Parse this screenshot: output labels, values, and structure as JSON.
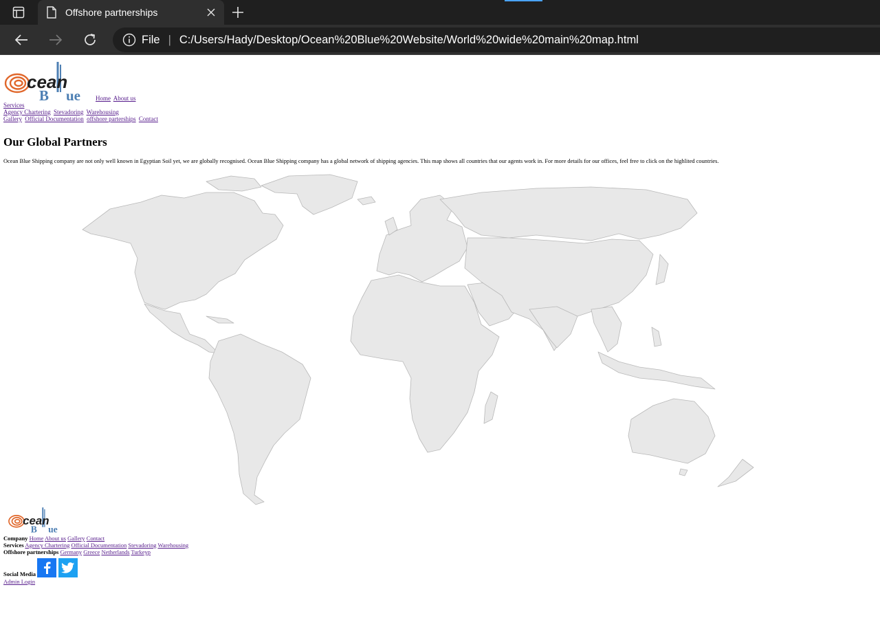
{
  "browser": {
    "tab_title": "Offshore partnerships",
    "address_scheme": "File",
    "address_separator": "|",
    "url": "C:/Users/Hady/Desktop/Ocean%20Blue%20Website/World%20wide%20main%20map.html"
  },
  "logo": {
    "word1": "cean",
    "word2a": "B",
    "word2b": "ue"
  },
  "header_nav": {
    "row1": [
      "Home",
      "About us"
    ],
    "row2": [
      "Services"
    ],
    "row3": [
      "Agency Chartering",
      "Stevadoring",
      "Warehousing"
    ],
    "row4": [
      "Gallery",
      "Official Documentation",
      "offshore parterships",
      "Contact"
    ]
  },
  "main": {
    "title": "Our Global Partners",
    "intro": "Ocean Blue Shipping company are not only well known in Egyptian Soil yet, we are globally recognised. Ocean Blue Shipping company has a global network of shipping agencies. This map shows all countries that our agents work in. For more details for our offices, feel free to click on the highlited countries."
  },
  "footer": {
    "company": {
      "label": "Company",
      "links": [
        "Home",
        "About us",
        "Gallery",
        "Contact"
      ]
    },
    "services": {
      "label": "Services",
      "links": [
        "Agency Chartering",
        "Official Documentation",
        "Stevadoring",
        "Warehousing"
      ]
    },
    "offshore": {
      "label": "Offshore partnerships",
      "links": [
        "Germany",
        "Greece",
        "Netherlands",
        "Turkeyp"
      ]
    },
    "social_label": "Social Media",
    "admin_link": "Admin Login"
  },
  "colors": {
    "logo_orange": "#e0672b",
    "logo_blue": "#4d7fb3",
    "land_fill": "#e8e8e8",
    "land_stroke": "#b8b8b8",
    "link": "#551a8b"
  },
  "icons": {
    "tab_actions": "tab-actions-icon",
    "page": "page-icon",
    "close": "close-icon",
    "new_tab": "plus-icon",
    "back": "back-arrow-icon",
    "forward": "forward-arrow-icon",
    "reload": "reload-icon",
    "info": "info-icon",
    "facebook": "facebook-icon",
    "twitter": "twitter-icon"
  }
}
